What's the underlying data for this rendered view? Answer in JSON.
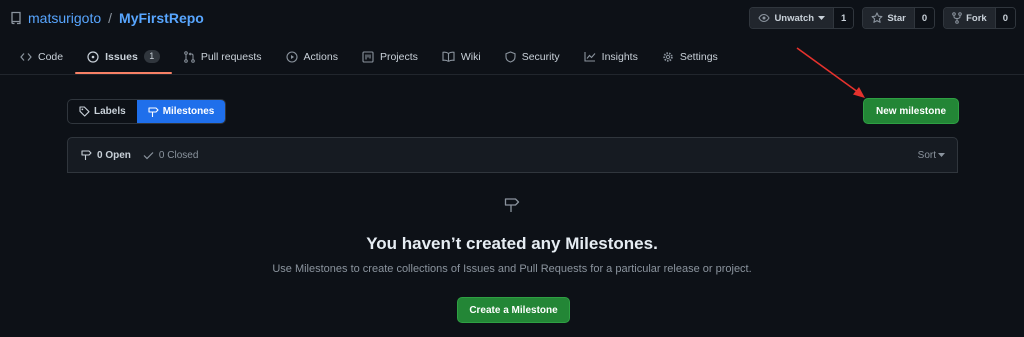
{
  "repo": {
    "owner": "matsurigoto",
    "separator": "/",
    "name": "MyFirstRepo",
    "icon": "repo-icon"
  },
  "repo_actions": {
    "watch": {
      "label": "Unwatch",
      "count": "1",
      "icon": "eye-icon"
    },
    "star": {
      "label": "Star",
      "count": "0",
      "icon": "star-icon"
    },
    "fork": {
      "label": "Fork",
      "count": "0",
      "icon": "repo-forked-icon"
    }
  },
  "tabs": [
    {
      "label": "Code",
      "icon": "code-icon"
    },
    {
      "label": "Issues",
      "icon": "issue-opened-icon",
      "counter": "1",
      "active": true
    },
    {
      "label": "Pull requests",
      "icon": "git-pull-request-icon"
    },
    {
      "label": "Actions",
      "icon": "play-icon"
    },
    {
      "label": "Projects",
      "icon": "project-icon"
    },
    {
      "label": "Wiki",
      "icon": "book-icon"
    },
    {
      "label": "Security",
      "icon": "shield-icon"
    },
    {
      "label": "Insights",
      "icon": "graph-icon"
    },
    {
      "label": "Settings",
      "icon": "gear-icon"
    }
  ],
  "subnav": {
    "labels": "Labels",
    "milestones": "Milestones",
    "selected": "Milestones"
  },
  "new_milestone_label": "New milestone",
  "states": {
    "open": "0 Open",
    "closed": "0 Closed"
  },
  "sort_label": "Sort",
  "blankslate": {
    "title": "You haven’t created any Milestones.",
    "description": "Use Milestones to create collections of Issues and Pull Requests for a particular release or project.",
    "button": "Create a Milestone",
    "icon": "milestone-icon"
  },
  "colors": {
    "background": "#0d1117",
    "link": "#58a6ff",
    "primary_button": "#238636",
    "selected_subnav": "#1f6feb",
    "active_tab_underline": "#f78166",
    "annotation_arrow": "#e5322d"
  }
}
